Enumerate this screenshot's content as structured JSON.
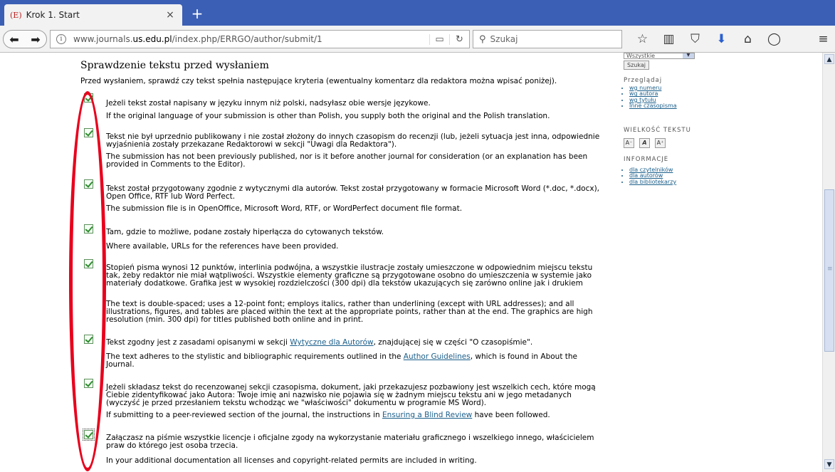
{
  "tab": {
    "favicon": "(E)",
    "title": "Krok 1. Start",
    "close": "×",
    "new_tab": "+"
  },
  "nav": {
    "back": "⬅",
    "forward": "➡",
    "info": "i",
    "url_prefix": "www.journals.",
    "url_domain": "us.edu.pl",
    "url_suffix": "/index.php/ERRGO/author/submit/1",
    "reader_icon": "▭",
    "reload_icon": "↻",
    "search_placeholder": "Szukaj",
    "icons": {
      "bookmark": "☆",
      "library": "▥",
      "pocket": "⛉",
      "download": "⬇",
      "home": "⌂",
      "chat": "◯",
      "menu": "≡"
    }
  },
  "page": {
    "title": "Sprawdzenie tekstu przed wysłaniem",
    "intro": "Przed wysłaniem, sprawdź czy tekst spełnia następujące kryteria (ewentualny komentarz dla redaktora można wpisać poniżej).",
    "items": [
      {
        "pl": "Jeżeli tekst został napisany w języku innym niż polski, nadsyłasz obie wersje językowe.",
        "en": "If the original language of your submission is other than Polish, you supply both the original and the Polish translation."
      },
      {
        "pl": "Tekst nie był uprzednio publikowany i nie został złożony do innych czasopism do recenzji (lub, jeżeli sytuacja jest inna, odpowiednie wyjaśnienia zostały przekazane Redaktorowi w sekcji \"Uwagi dla Redaktora\").",
        "en": "The submission has not been previously published, nor is it before another journal for consideration (or an explanation has been provided in Comments to the Editor)."
      },
      {
        "pl": "Tekst został przygotowany zgodnie z wytycznymi dla autorów. Tekst został przygotowany w formacie Microsoft Word (*.doc, *.docx), Open Office, RTF lub Word Perfect.",
        "en": "The submission file is in OpenOffice, Microsoft Word, RTF, or WordPerfect document file format."
      },
      {
        "pl": "Tam, gdzie to możliwe, podane zostały hiperłącza do cytowanych tekstów.",
        "en": "Where available, URLs for the references have been provided."
      },
      {
        "pl": "Stopień pisma wynosi 12 punktów, interlinia podwójna, a wszystkie ilustracje zostały umieszczone w odpowiednim miejscu tekstu tak, żeby redaktor nie miał wątpliwości. Wszystkie elementy graficzne są przygotowane osobno do umieszczenia w systemie jako materiały dodatkowe. Grafika jest w wysokiej rozdzielczości (300 dpi) dla tekstów ukazujących się zarówno online jak i drukiem",
        "en": "The text is double-spaced; uses a 12-point font; employs italics, rather than underlining (except with URL addresses); and all illustrations, figures, and tables are placed within the text at the appropriate points, rather than at the end. The graphics are high resolution (min. 300 dpi) for titles published both online and in print."
      },
      {
        "pl_before": "Tekst zgodny jest z zasadami opisanymi w sekcji ",
        "pl_link": "Wytyczne dla Autorów",
        "pl_after": ", znajdującej się w części \"O czasopiśmie\".",
        "en_before": "The text adheres to the stylistic and bibliographic requirements outlined in the ",
        "en_link": "Author Guidelines",
        "en_after": ", which is found in About the Journal."
      },
      {
        "pl": "Jeżeli składasz tekst do recenzowanej sekcji czasopisma, dokument, jaki przekazujesz pozbawiony jest wszelkich cech, które mogą Ciebie zidentyfikować jako Autora: Twoje imię ani nazwisko nie pojawia się w żadnym miejscu tekstu ani w jego metadanych (wyczyść je przed przesłaniem tekstu wchodząc we \"właściwości\" dokumentu w programie MS Word).",
        "en_before": "If submitting to a peer-reviewed section of the journal, the instructions in ",
        "en_link": "Ensuring a Blind Review",
        "en_after": " have been followed."
      },
      {
        "pl": "Załączasz na piśmie wszystkie licencje i oficjalne zgody na wykorzystanie materiału graficznego i wszelkiego innego, właścicielem praw do którego jest osoba trzecia.",
        "en": "In your additional documentation all licenses and copyright-related permits are included in writing."
      }
    ]
  },
  "sidebar": {
    "select_value": "Wszystkie",
    "search_button": "Szukaj",
    "browse_heading": "Przeglądaj",
    "browse_links": [
      "wg numeru",
      "wg autora",
      "wg tytułu",
      "Inne czasopisma"
    ],
    "font_heading": "WIELKOŚĆ TEKSTU",
    "font_buttons": [
      "A⁻",
      "A",
      "A⁺"
    ],
    "info_heading": "INFORMACJE",
    "info_links": [
      "dla czytelników",
      "dla autorów",
      "dla bibliotekarzy"
    ]
  },
  "annotation": {
    "color": "#e8001c"
  },
  "scrollbar": {
    "up": "▲",
    "down": "▼",
    "grip": "≡"
  }
}
